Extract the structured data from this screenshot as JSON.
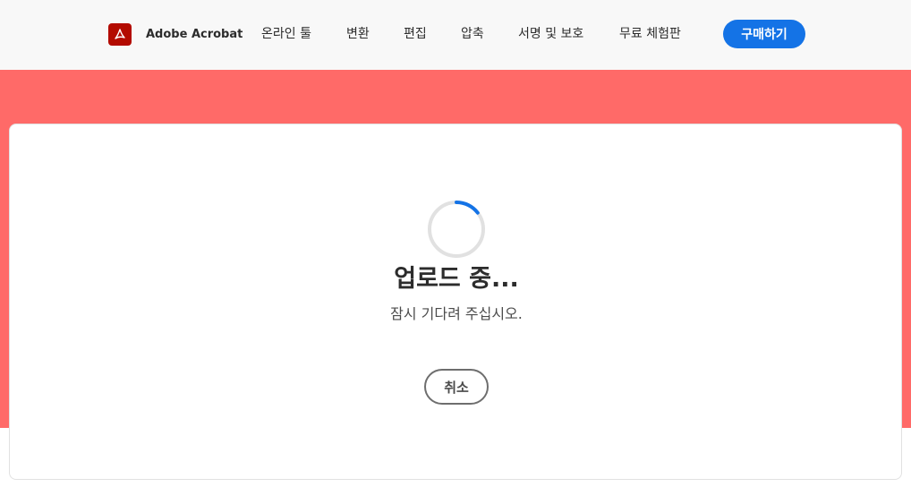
{
  "header": {
    "brand_name": "Adobe Acrobat",
    "logo_icon": "adobe-acrobat-logo-icon",
    "nav": [
      {
        "label": "온라인 툴"
      },
      {
        "label": "변환"
      },
      {
        "label": "편집"
      },
      {
        "label": "압축"
      },
      {
        "label": "서명 및 보호"
      },
      {
        "label": "무료 체험판"
      }
    ],
    "buy_label": "구매하기"
  },
  "upload": {
    "spinner_icon": "loading-spinner-icon",
    "title": "업로드 중...",
    "subtitle": "잠시 기다려 주십시오.",
    "cancel_label": "취소"
  },
  "colors": {
    "accent": "#1473e6",
    "brand_red": "#b30b00",
    "hero_band": "#ff6a68"
  }
}
